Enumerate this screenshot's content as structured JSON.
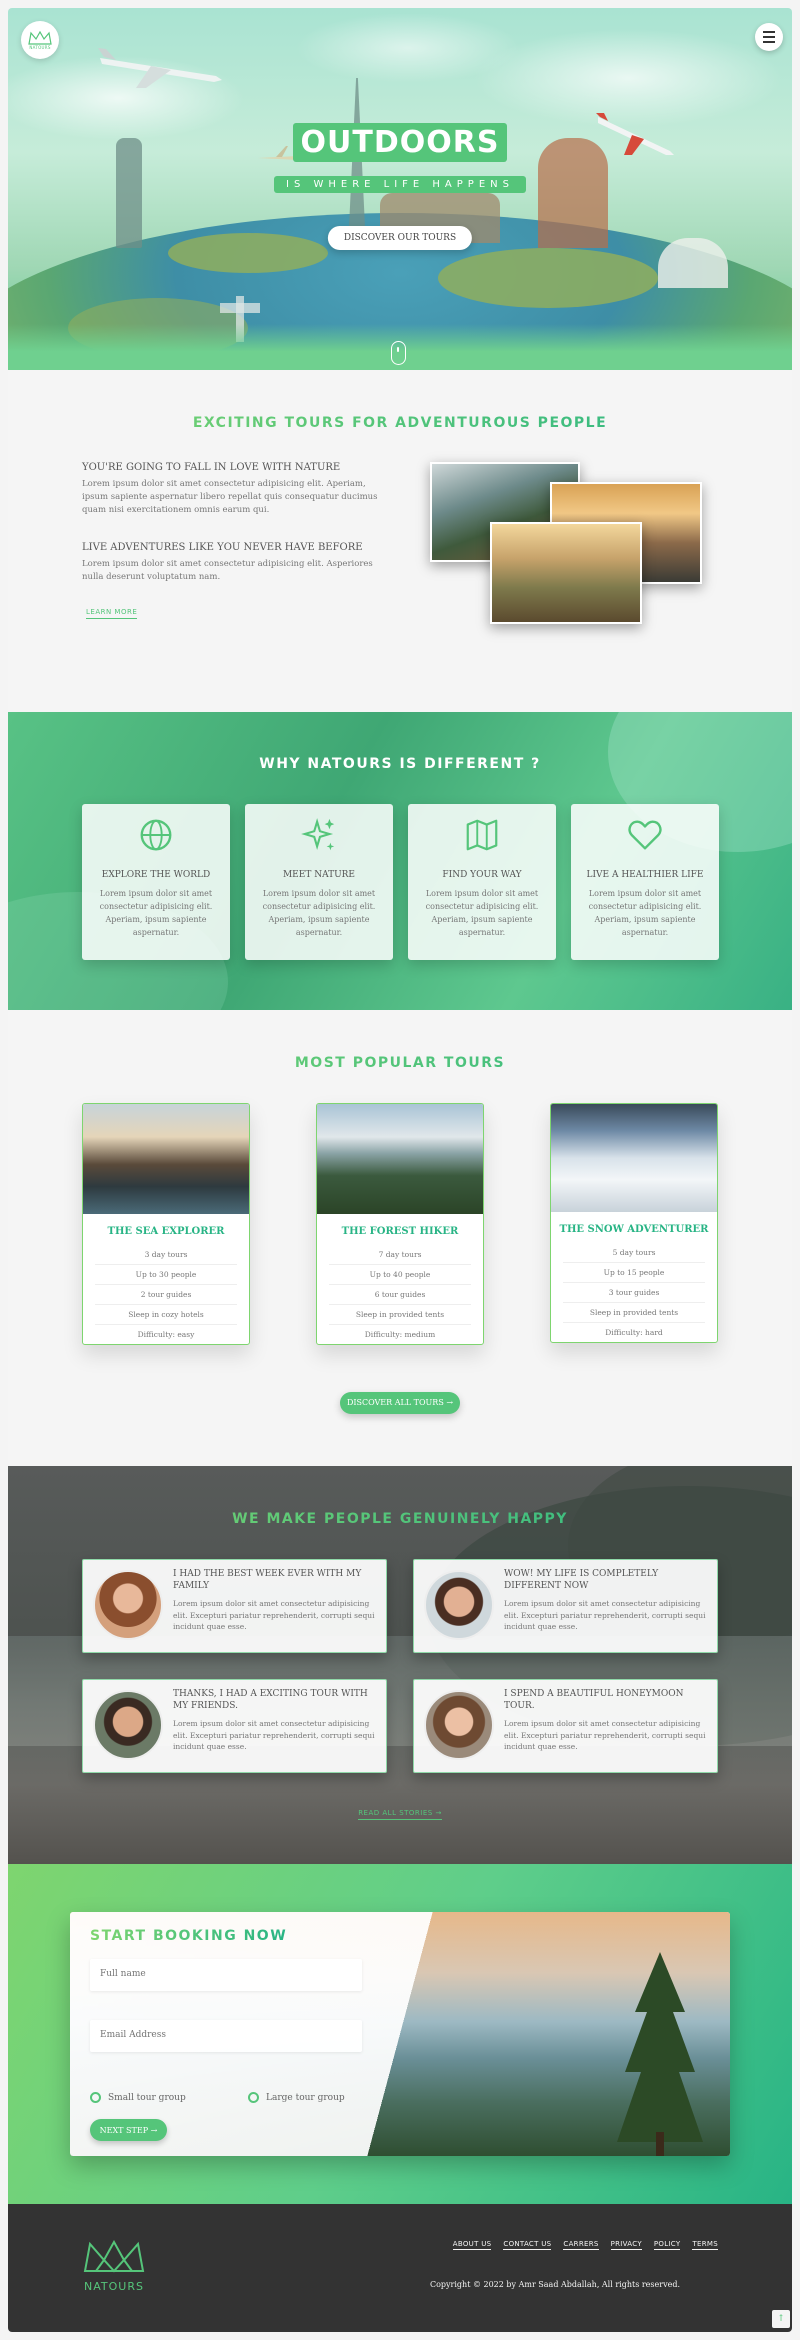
{
  "hero": {
    "logo_text": "NATOURS",
    "title": "OUTDOORS",
    "subtitle": "IS WHERE LIFE HAPPENS",
    "cta": "DISCOVER OUR TOURS"
  },
  "about": {
    "title": "EXCITING TOURS FOR ADVENTUROUS PEOPLE",
    "h1": "YOU'RE GOING TO FALL IN LOVE WITH NATURE",
    "p1": "Lorem ipsum dolor sit amet consectetur adipisicing elit. Aperiam, ipsum sapiente aspernatur libero repellat quis consequatur ducimus quam nisi exercitationem omnis earum qui.",
    "h2": "LIVE ADVENTURES LIKE YOU NEVER HAVE BEFORE",
    "p2": "Lorem ipsum dolor sit amet consectetur adipisicing elit. Asperiores nulla deserunt voluptatum nam.",
    "learn_more": "LEARN MORE"
  },
  "features": {
    "title": "WHY NATOURS IS DIFFERENT ?",
    "items": [
      {
        "title": "EXPLORE THE WORLD",
        "text": "Lorem ipsum dolor sit amet consectetur adipisicing elit. Aperiam, ipsum sapiente aspernatur.",
        "icon": "globe-icon"
      },
      {
        "title": "MEET NATURE",
        "text": "Lorem ipsum dolor sit amet consectetur adipisicing elit. Aperiam, ipsum sapiente aspernatur.",
        "icon": "sparkles-icon"
      },
      {
        "title": "FIND YOUR WAY",
        "text": "Lorem ipsum dolor sit amet consectetur adipisicing elit. Aperiam, ipsum sapiente aspernatur.",
        "icon": "map-icon"
      },
      {
        "title": "LIVE A HEALTHIER LIFE",
        "text": "Lorem ipsum dolor sit amet consectetur adipisicing elit. Aperiam, ipsum sapiente aspernatur.",
        "icon": "heart-icon"
      }
    ]
  },
  "tours": {
    "title": "MOST POPULAR TOURS",
    "cards": [
      {
        "name": "THE SEA EXPLORER",
        "details": [
          "3 day tours",
          "Up to 30 people",
          "2 tour guides",
          "Sleep in cozy hotels",
          "Difficulty: easy"
        ]
      },
      {
        "name": "THE FOREST HIKER",
        "details": [
          "7 day tours",
          "Up to 40 people",
          "6 tour guides",
          "Sleep in provided tents",
          "Difficulty: medium"
        ]
      },
      {
        "name": "THE SNOW ADVENTURER",
        "details": [
          "5 day tours",
          "Up to 15 people",
          "3 tour guides",
          "Sleep in provided tents",
          "Difficulty: hard"
        ]
      }
    ],
    "cta": "DISCOVER ALL TOURS →"
  },
  "stories": {
    "title": "WE MAKE PEOPLE GENUINELY HAPPY",
    "items": [
      {
        "heading": "I HAD THE BEST WEEK EVER WITH MY FAMILY",
        "text": "Lorem ipsum dolor sit amet consectetur adipisicing elit. Excepturi pariatur reprehenderit, corrupti sequi incidunt quae esse."
      },
      {
        "heading": "WOW! MY LIFE IS COMPLETELY DIFFERENT NOW",
        "text": "Lorem ipsum dolor sit amet consectetur adipisicing elit. Excepturi pariatur reprehenderit, corrupti sequi incidunt quae esse."
      },
      {
        "heading": "THANKS, I HAD A EXCITING TOUR WITH MY FRIENDS.",
        "text": "Lorem ipsum dolor sit amet consectetur adipisicing elit. Excepturi pariatur reprehenderit, corrupti sequi incidunt quae esse."
      },
      {
        "heading": "I SPEND A BEAUTIFUL HONEYMOON TOUR.",
        "text": "Lorem ipsum dolor sit amet consectetur adipisicing elit. Excepturi pariatur reprehenderit, corrupti sequi incidunt quae esse."
      }
    ],
    "read_all": "READ ALL STORIES →"
  },
  "booking": {
    "title": "START BOOKING NOW",
    "full_name_placeholder": "Full name",
    "email_placeholder": "Email Address",
    "small_group": "Small tour group",
    "large_group": "Large tour group",
    "next": "NEXT STEP →"
  },
  "footer": {
    "logo_text": "NATOURS",
    "links": [
      "ABOUT US",
      "CONTACT US",
      "CARRERS",
      "PRIVACY",
      "POLICY",
      "TERMS"
    ],
    "copyright": "Copyright © 2022 by Amr Saad Abdallah, All rights reserved.",
    "to_top": "↑"
  },
  "colors": {
    "primary": "#55c57a",
    "primary_light": "#7ed56f",
    "primary_dark": "#28b485",
    "footer_bg": "#333333"
  }
}
